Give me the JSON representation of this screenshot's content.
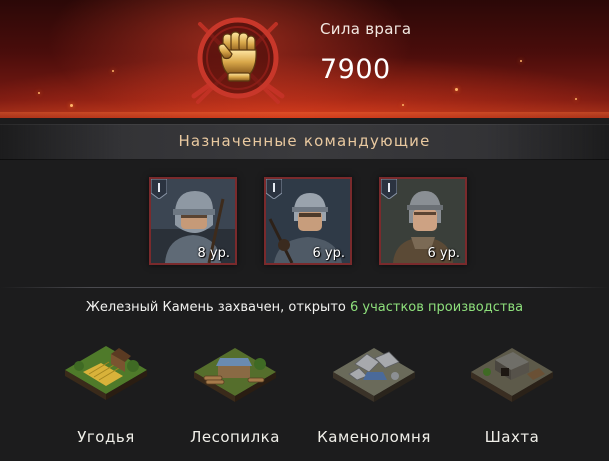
{
  "enemy": {
    "label": "Сила врага",
    "value": "7900",
    "icon": "fist-icon"
  },
  "commanders_section": {
    "title": "Назначенные командующие",
    "commanders": [
      {
        "rank": "I",
        "level": "8 ур."
      },
      {
        "rank": "I",
        "level": "6 ур."
      },
      {
        "rank": "I",
        "level": "6 ур."
      }
    ]
  },
  "capture": {
    "prefix": "Железный Камень захвачен, открыто ",
    "highlight": "6 участков производства"
  },
  "buildings": [
    {
      "label": "Угодья",
      "icon": "farmland-icon"
    },
    {
      "label": "Лесопилка",
      "icon": "sawmill-icon"
    },
    {
      "label": "Каменоломня",
      "icon": "quarry-icon"
    },
    {
      "label": "Шахта",
      "icon": "mine-icon"
    }
  ],
  "colors": {
    "banner_red": "#7a1a12",
    "card_border": "#7a2a2c",
    "highlight_green": "#8ee07c",
    "title_gold": "#e9c9a0"
  }
}
